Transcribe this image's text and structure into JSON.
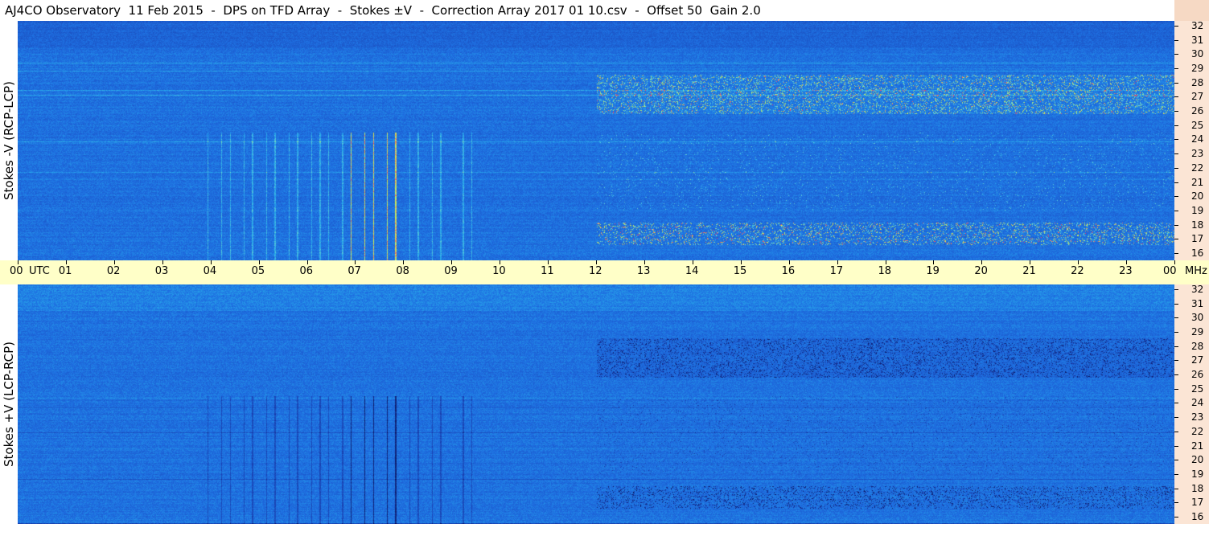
{
  "title": "AJ4CO Observatory  11 Feb 2015  -  DPS on TFD Array  -  Stokes ±V  -  Correction Array 2017 01 10.csv  -  Offset 50  Gain 2.0",
  "panels": [
    {
      "ylabel": "Stokes -V (RCP-LCP)",
      "palette": "positive"
    },
    {
      "ylabel": "Stokes +V (LCP-RCP)",
      "palette": "negative"
    }
  ],
  "freq_axis": {
    "unit": "MHz",
    "ticks": [
      "16",
      "17",
      "18",
      "19",
      "20",
      "21",
      "22",
      "23",
      "24",
      "25",
      "26",
      "27",
      "28",
      "29",
      "30",
      "31",
      "32"
    ]
  },
  "time_axis": {
    "labels": [
      "00",
      "01",
      "02",
      "03",
      "04",
      "05",
      "06",
      "07",
      "08",
      "09",
      "10",
      "11",
      "12",
      "13",
      "14",
      "15",
      "16",
      "17",
      "18",
      "19",
      "20",
      "21",
      "22",
      "23",
      "00"
    ],
    "unit_label": "UTC",
    "end_unit": "MHz"
  },
  "chart_data": {
    "type": "heatmap",
    "title": "AJ4CO Observatory  11 Feb 2015  -  DPS on TFD Array  -  Stokes ±V  -  Correction Array 2017 01 10.csv  -  Offset 50  Gain 2.0",
    "x_range": [
      "00 UTC",
      "00"
    ],
    "y_range_mhz": [
      16,
      32
    ],
    "series": [
      {
        "name": "Stokes -V (RCP-LCP)",
        "notes": "bursts near 07-08 UTC at 17-24 MHz; banded emission 12-24 UTC at 26-28 MHz and 17-18 MHz"
      },
      {
        "name": "Stokes +V (LCP-RCP)",
        "notes": "inverse of upper panel"
      }
    ],
    "colors": {
      "background": "#1f6fe0",
      "low": "#0a1a6a",
      "mid": "#2aa8e8",
      "high": "#d8f040",
      "peak": "#ff3060"
    }
  }
}
